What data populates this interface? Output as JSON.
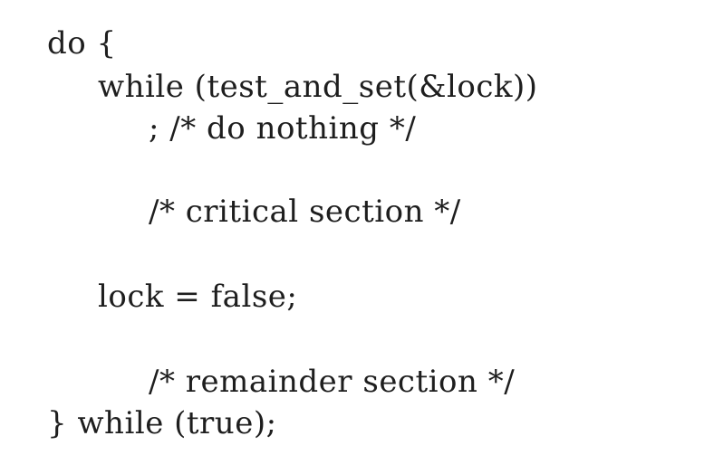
{
  "code": {
    "lines": [
      "do {",
      "while (test_and_set(&lock))",
      "; /* do nothing */",
      "/* critical section */",
      "lock = false;",
      "/* remainder section */",
      "} while (true);"
    ]
  }
}
